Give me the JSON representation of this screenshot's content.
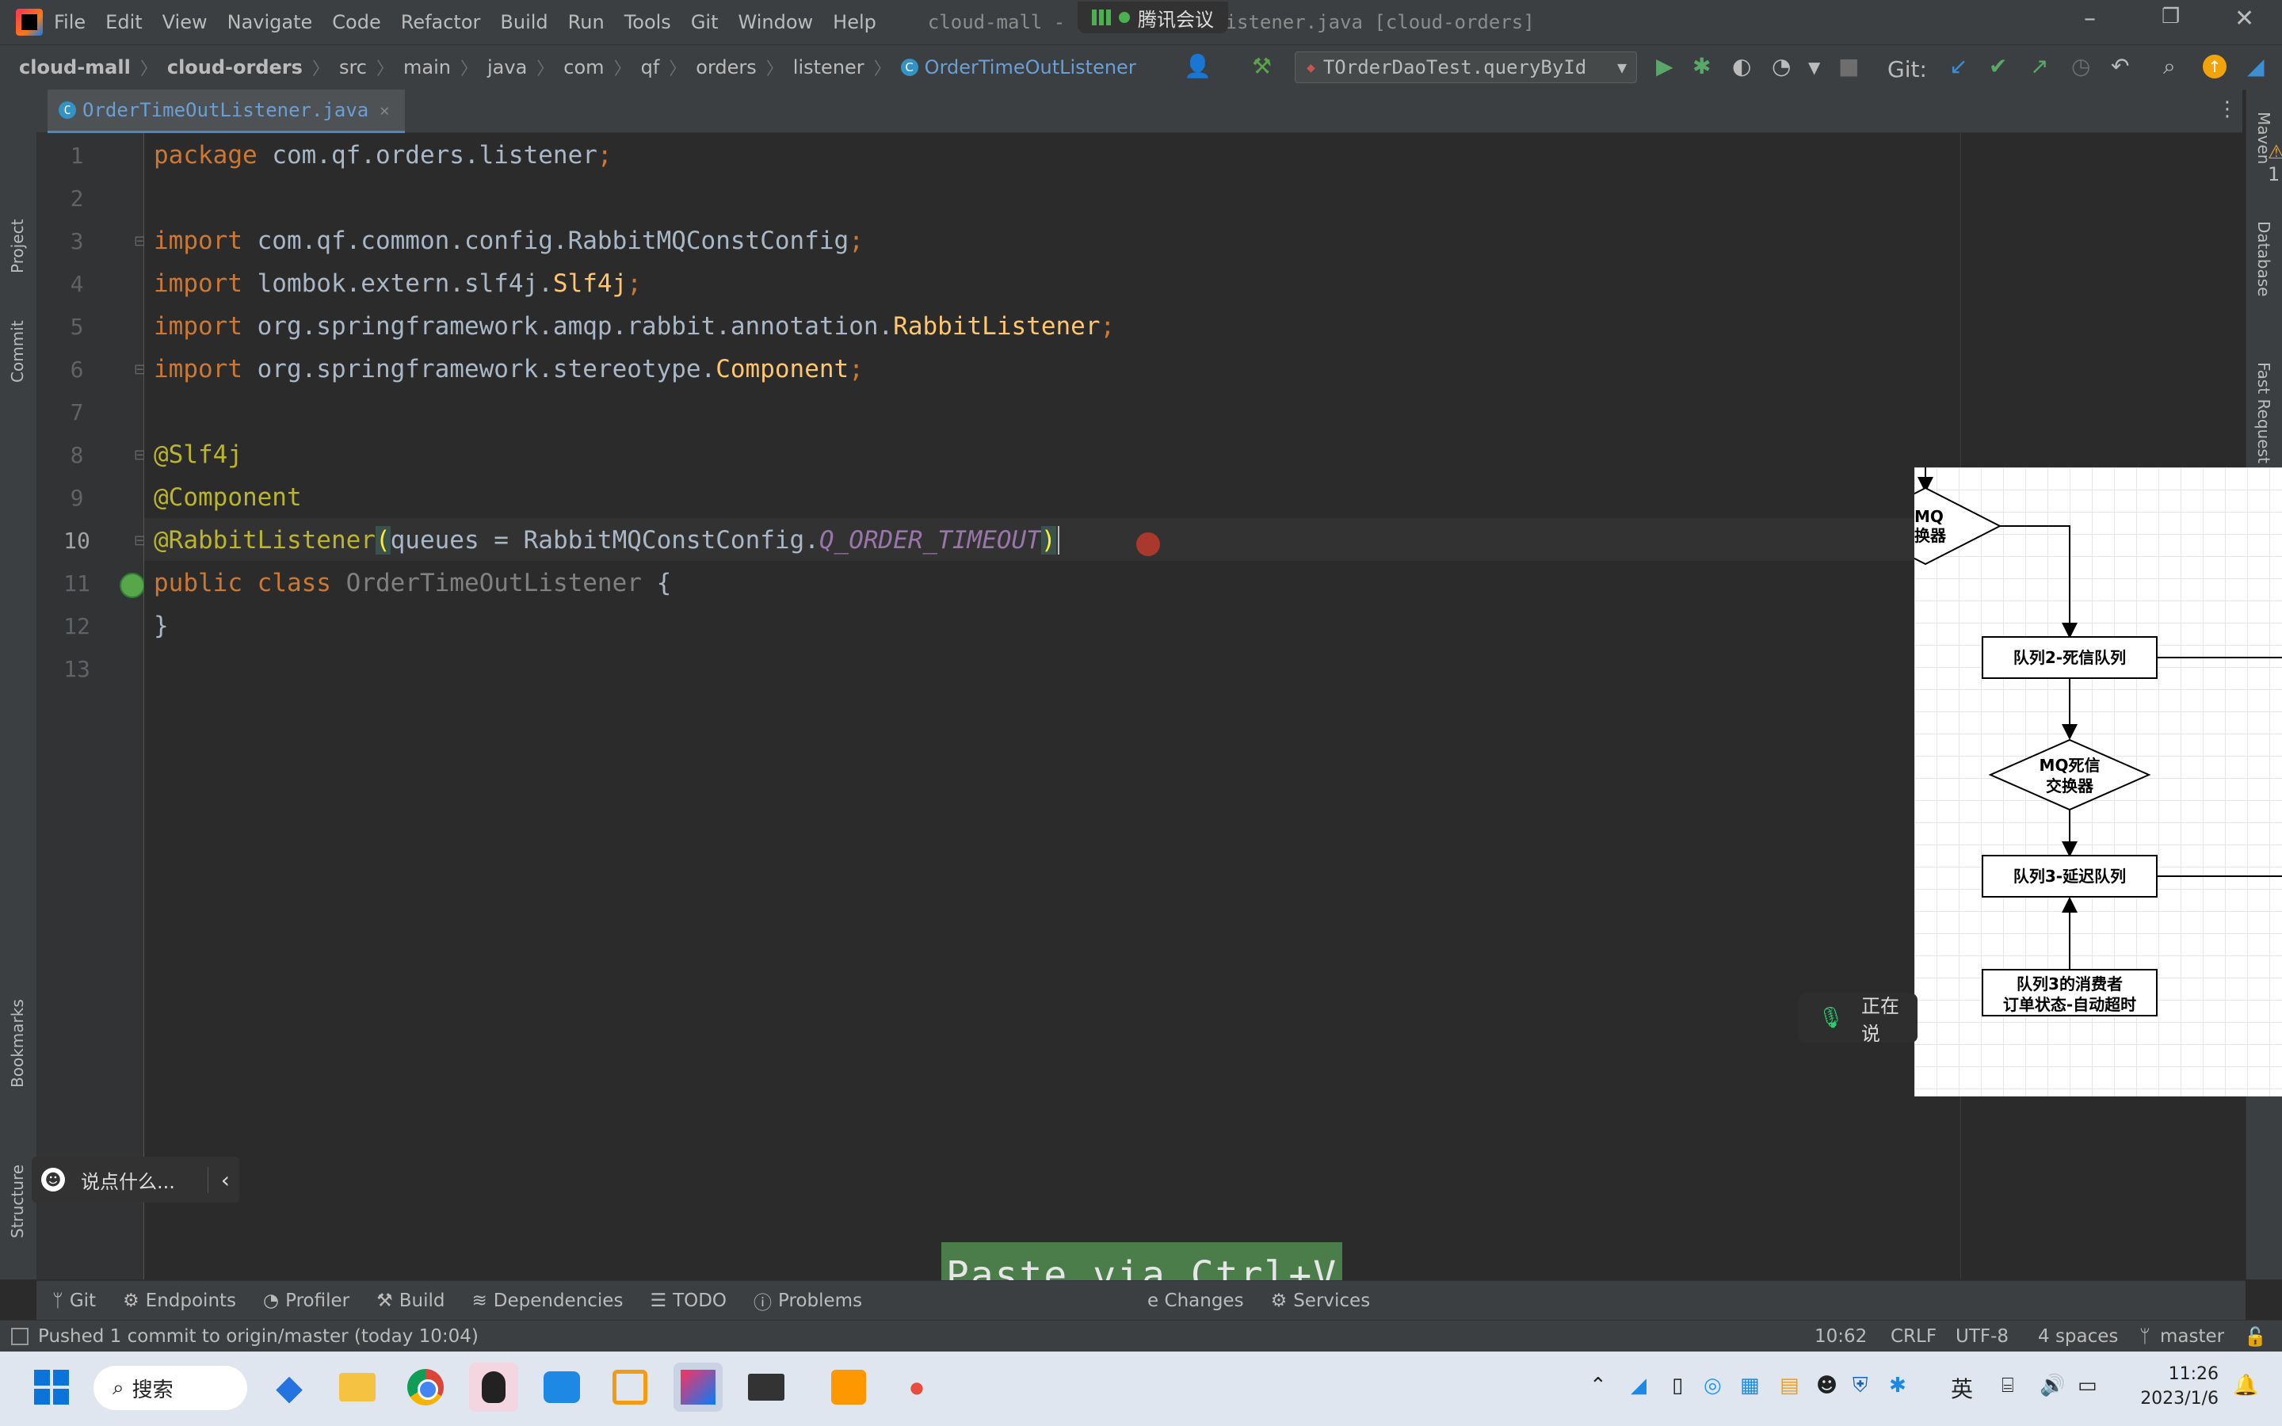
{
  "menu": [
    "File",
    "Edit",
    "View",
    "Navigate",
    "Code",
    "Refactor",
    "Build",
    "Run",
    "Tools",
    "Git",
    "Window",
    "Help"
  ],
  "window_title": "cloud-mall - OrderTimeOutListener.java [cloud-orders]",
  "meeting_label": "腾讯会议",
  "breadcrumb": [
    "cloud-mall",
    "cloud-orders",
    "src",
    "main",
    "java",
    "com",
    "qf",
    "orders",
    "listener",
    "OrderTimeOutListener"
  ],
  "run_config": "TOrderDaoTest.queryById",
  "git_label": "Git:",
  "tab": {
    "label": "OrderTimeOutListener.java"
  },
  "left_strip": [
    "Project",
    "Commit",
    "Bookmarks",
    "Structure"
  ],
  "right_strip": [
    "Maven",
    "Database",
    "Fast Request"
  ],
  "inspection_count": "1",
  "line_numbers": [
    "1",
    "2",
    "3",
    "4",
    "5",
    "6",
    "7",
    "8",
    "9",
    "10",
    "11",
    "12",
    "13"
  ],
  "code": {
    "l1_kw": "package",
    "l1_rest": " com.qf.orders.listener",
    "l1_semi": ";",
    "l3_kw": "import",
    "l3_rest": " com.qf.common.config.RabbitMQConstConfig",
    "l3_semi": ";",
    "l4_kw": "import",
    "l4_rest": " lombok.extern.slf4j.",
    "l4_cls": "Slf4j",
    "l4_semi": ";",
    "l5_kw": "import",
    "l5_rest": " org.springframework.amqp.rabbit.annotation.",
    "l5_cls": "RabbitListener",
    "l5_semi": ";",
    "l6_kw": "import",
    "l6_rest": " org.springframework.stereotype.",
    "l6_cls": "Component",
    "l6_semi": ";",
    "l8_ann": "@Slf4j",
    "l9_ann": "@Component",
    "l10_ann": "@RabbitListener",
    "l10_open": "(",
    "l10_mid": "queues = RabbitMQConstConfig.",
    "l10_const": "Q_ORDER_TIMEOUT",
    "l10_close": ")",
    "l11_kw1": "public",
    "l11_kw2": "class",
    "l11_name": "OrderTimeOutListener",
    "l11_brace": "{",
    "l12_brace": "}"
  },
  "diagram": {
    "exchange_top": "MQ\n换器",
    "queue2": "队列2-死信队列",
    "dead_exchange_1": "MQ死信",
    "dead_exchange_2": "交换器",
    "queue3": "队列3-延迟队列",
    "consumer_1": "队列3的消费者",
    "consumer_2": "订单状态-自动超时"
  },
  "voice_pill_text": "正在说",
  "chat_placeholder": "说点什么...",
  "paste_tip": "Paste via Ctrl+V",
  "bottom_tools": [
    "Git",
    "Endpoints",
    "Profiler",
    "Build",
    "Dependencies",
    "TODO",
    "Problems",
    "e Changes",
    "Services"
  ],
  "status": {
    "message": "Pushed 1 commit to origin/master (today 10:04)",
    "position": "10:62",
    "line_sep": "CRLF",
    "encoding": "UTF-8",
    "indent": "4 spaces",
    "branch": "master"
  },
  "taskbar": {
    "search": "搜索",
    "ime": "英",
    "time": "11:26",
    "date": "2023/1/6"
  },
  "colors": {
    "keyword": "#cc7832",
    "annotation": "#bbb529",
    "class": "#ffc66d",
    "constant": "#9876aa",
    "accent": "#4a88c7"
  }
}
